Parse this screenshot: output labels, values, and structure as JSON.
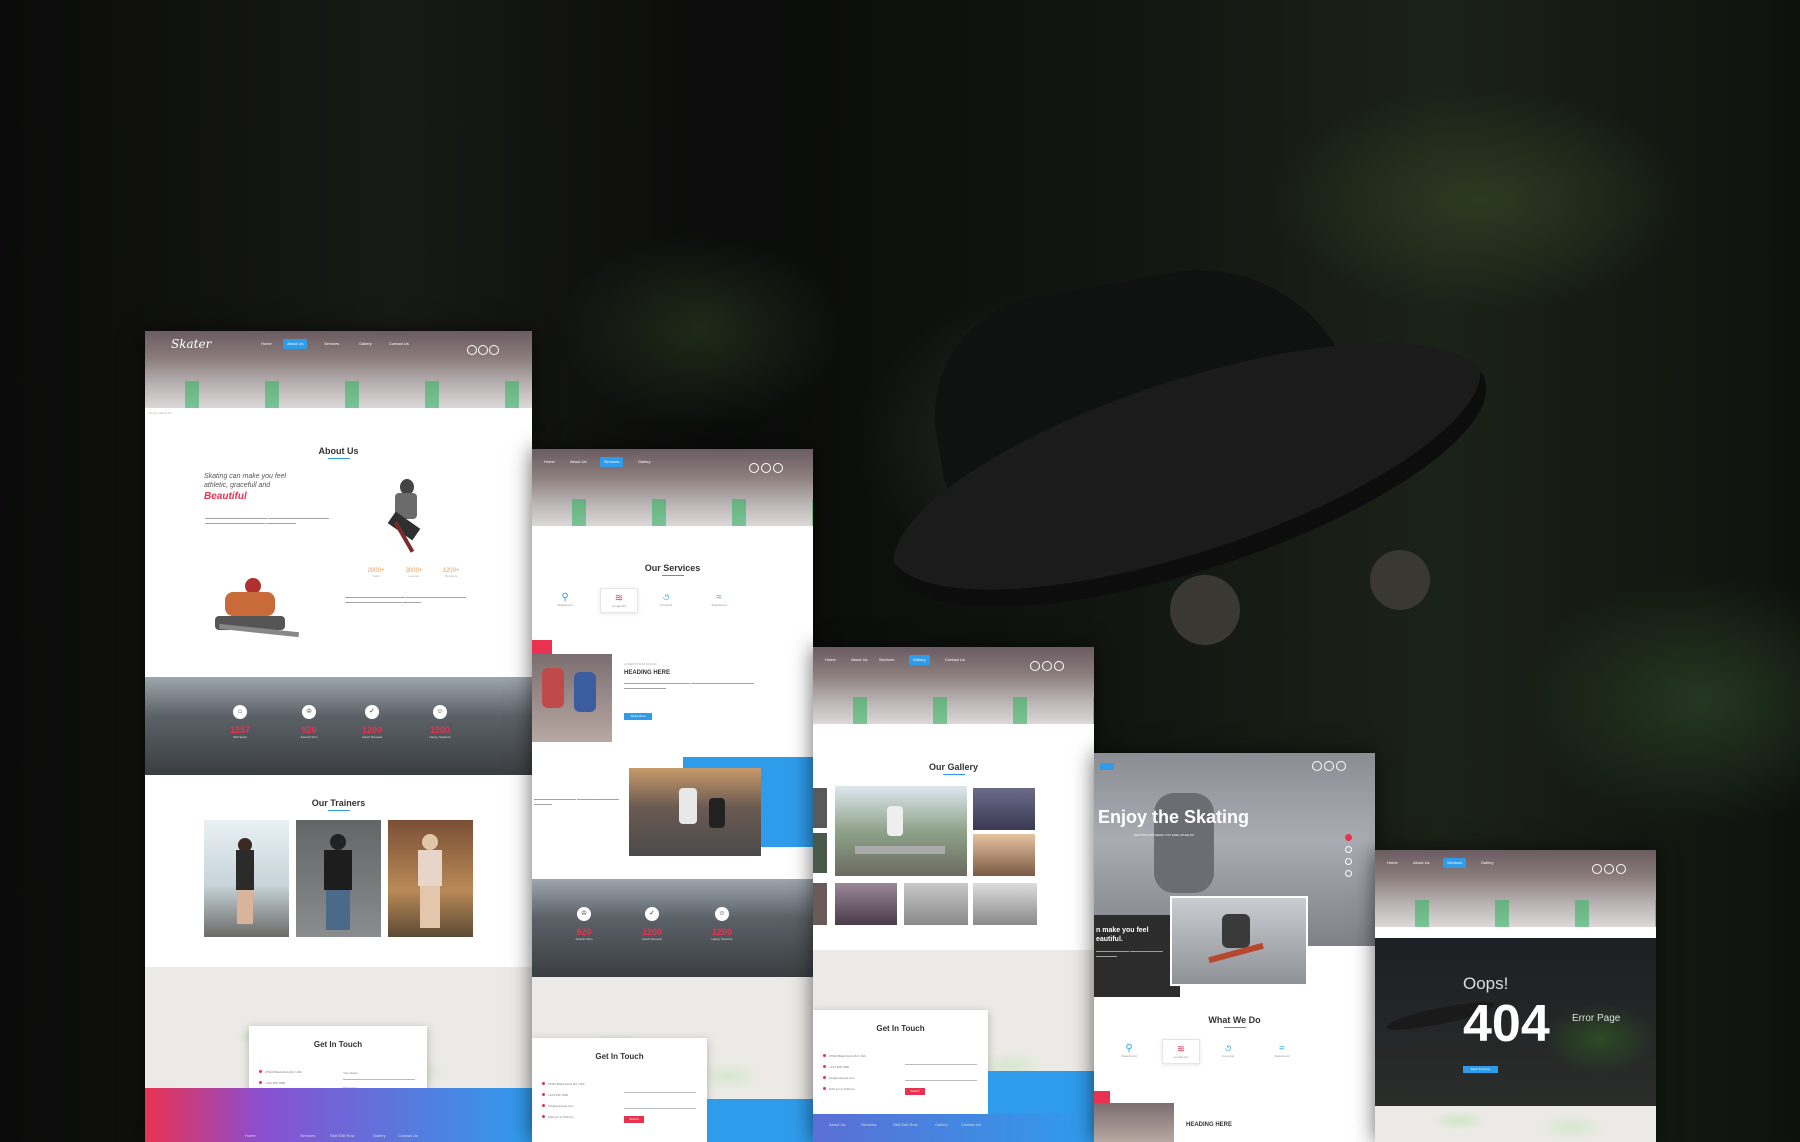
{
  "brand": {
    "logo_text": "Skater",
    "accent_blue": "#2f9ceb",
    "accent_red": "#e8324f"
  },
  "nav": {
    "links": [
      "Home",
      "About Us",
      "Services",
      "Gallery",
      "Contact Us"
    ]
  },
  "about_page": {
    "breadcrumb": [
      "Home",
      "About Us"
    ],
    "title": "About Us",
    "tagline_line1": "Skating can make you feel",
    "tagline_line2": "athletic, gracefull and",
    "tagline_emphasis": "Beautiful",
    "mini_stats": [
      {
        "num": "2000+",
        "label": "Years"
      },
      {
        "num": "3000+",
        "label": "Lessons"
      },
      {
        "num": "1200+",
        "label": "Members"
      }
    ],
    "counters": [
      {
        "num": "1257",
        "label": "Skill Spots"
      },
      {
        "num": "920",
        "label": "Awards Won"
      },
      {
        "num": "1200",
        "label": "Latest Reviews"
      },
      {
        "num": "1200",
        "label": "Happy Students"
      }
    ],
    "trainers_title": "Our Trainers",
    "contact_title": "Get In Touch",
    "contact_info": [
      "27010 Black Rock Rd, USA",
      "+123 456 7890",
      "info@example.com",
      "9:00 am to 6:00 pm"
    ],
    "contact_fields": [
      "Your Name",
      "Password"
    ],
    "submit_label": "Submit",
    "footer_links": [
      "Home",
      "Services",
      "Skill Edit Row",
      "Gallery",
      "Contact Us"
    ]
  },
  "services_page": {
    "title": "Our Services",
    "services": [
      "Skateboard",
      "Longboard",
      "Freestyle",
      "Skateboard"
    ],
    "kicker": "LOREM IPSUM DOLOR",
    "heading": "HEADING HERE",
    "read_more": "Read More",
    "counters": [
      {
        "num": "920",
        "label": "Awards Won"
      },
      {
        "num": "1200",
        "label": "Latest Reviews"
      },
      {
        "num": "1200",
        "label": "Happy Students"
      }
    ],
    "contact_title": "Get In Touch",
    "submit_label": "Submit"
  },
  "gallery_page": {
    "title": "Our Gallery",
    "contact_title": "Get In Touch",
    "submit_label": "Submit",
    "footer_links": [
      "About Us",
      "Services",
      "Skill Edit Row",
      "Gallery",
      "Contact Us"
    ]
  },
  "home_page": {
    "hero_title": "Enjoy the Skating",
    "hero_sub": "GETTING FUN MAKE YOU FEEL ATHLETIC",
    "intro_line1": "n make you feel",
    "intro_line2": "eautiful.",
    "what_title": "What We Do",
    "services": [
      "Skateboard",
      "Longboard",
      "Freestyle",
      "Skateboard"
    ],
    "heading": "HEADING HERE"
  },
  "error_page": {
    "oops": "Oops!",
    "code": "404",
    "label": "Error Page",
    "button": "Back To Home"
  }
}
